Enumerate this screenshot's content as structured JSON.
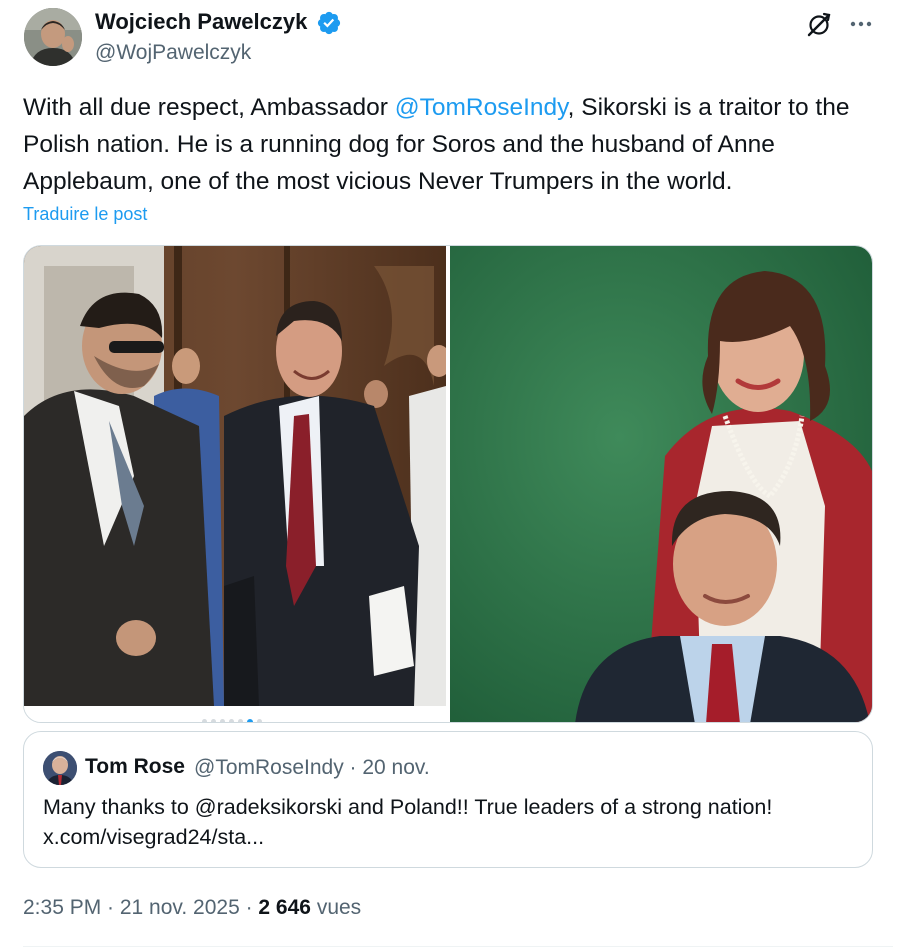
{
  "author": {
    "name": "Wojciech Pawelczyk",
    "handle": "@WojPawelczyk",
    "verified_icon": "verified-badge-icon"
  },
  "actions": {
    "grok_icon": "grok-icon",
    "more_icon": "more-options-icon"
  },
  "tweet": {
    "text_before": "With all due respect, Ambassador ",
    "mention": "@TomRoseIndy",
    "text_after": ", Sikorski is a traitor to the Polish nation. He is a running dog for Soros and the husband of Anne Applebaum, one of the most vicious Never Trumpers in the world.",
    "translate_label": "Traduire le post"
  },
  "media": {
    "carousel_dots": 7,
    "active_dot": 5
  },
  "quote": {
    "name": "Tom Rose",
    "handle_date": "@TomRoseIndy · 20 nov.",
    "text": "Many thanks to @radeksikorski and Poland!! True leaders of a strong nation! x.com/visegrad24/sta..."
  },
  "meta": {
    "time_date": "2:35 PM · 21 nov. 2025 · ",
    "views_count": "2 646",
    "views_label": " vues"
  },
  "colors": {
    "link": "#1d9bf0",
    "secondary_text": "#536471",
    "primary_text": "#0f1419",
    "border": "#cfd9de"
  }
}
